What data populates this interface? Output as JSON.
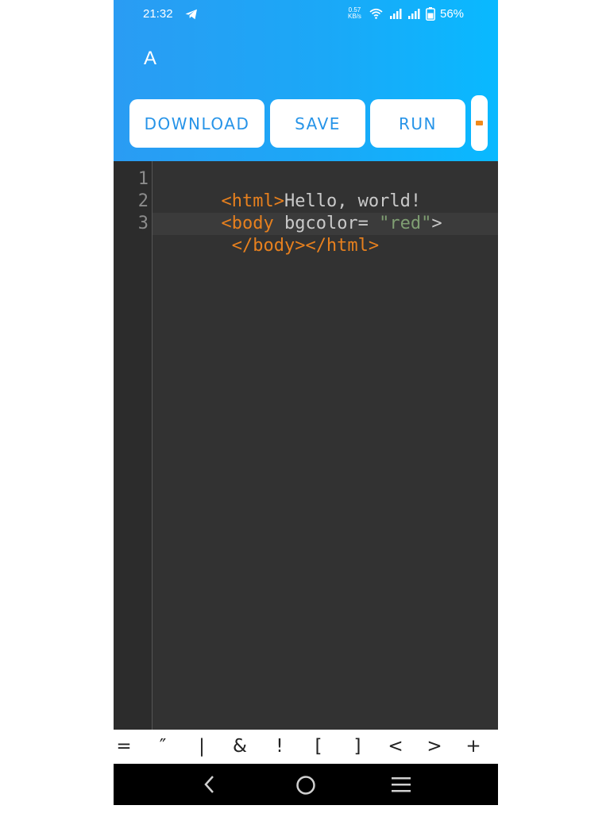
{
  "status": {
    "time": "21:32",
    "net_speed_value": "0.57",
    "net_speed_unit": "KB/s",
    "battery": "56%"
  },
  "app": {
    "title": "A"
  },
  "toolbar": {
    "download_label": "DOWNLOAD",
    "save_label": "SAVE",
    "run_label": "RUN"
  },
  "editor": {
    "line_numbers": [
      "1",
      "2",
      "3"
    ],
    "lines": [
      [
        {
          "t": "tag",
          "v": "<html>"
        },
        {
          "t": "txt",
          "v": "Hello, world!"
        }
      ],
      [
        {
          "t": "tag",
          "v": "<body"
        },
        {
          "t": "txt",
          "v": " bgcolor= "
        },
        {
          "t": "str",
          "v": "\"red\""
        },
        {
          "t": "txt",
          "v": ">"
        }
      ],
      [
        {
          "t": "tag",
          "v": " </body></html>"
        }
      ]
    ]
  },
  "symbols": [
    "=",
    "″",
    "|",
    "&",
    "!",
    "[",
    "]",
    "<",
    ">",
    "+"
  ],
  "colors": {
    "appbar_start": "#2a9cf3",
    "appbar_end": "#09b9ff",
    "button_text": "#2794e8",
    "tag": "#e7801e",
    "string": "#7f9e72",
    "editor_bg": "#323232"
  }
}
